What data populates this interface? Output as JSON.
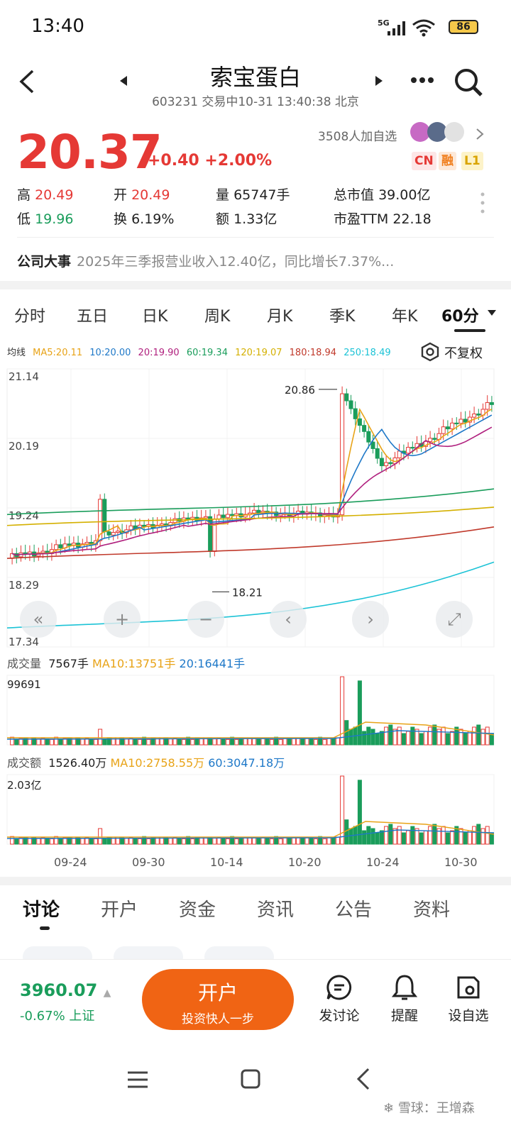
{
  "status": {
    "time": "13:40",
    "network": "5G",
    "battery": "86"
  },
  "header": {
    "title": "索宝蛋白",
    "subtitle": "603231 交易中10-31 13:40:38 北京"
  },
  "quote": {
    "price": "20.37",
    "change": "+0.40",
    "change_pct": "+2.00%",
    "followers": "3508人加自选",
    "badges": [
      "CN",
      "融",
      "L1"
    ],
    "stats": [
      {
        "label": "高",
        "value": "20.49",
        "color": "red"
      },
      {
        "label": "开",
        "value": "20.49",
        "color": "red"
      },
      {
        "label": "量",
        "value": "65747手",
        "color": "none"
      },
      {
        "label": "总市值",
        "value": "39.00亿",
        "color": "none"
      },
      {
        "label": "低",
        "value": "19.96",
        "color": "grn"
      },
      {
        "label": "换",
        "value": "6.19%",
        "color": "none"
      },
      {
        "label": "额",
        "value": "1.33亿",
        "color": "none"
      },
      {
        "label": "市盈TTM",
        "value": "22.18",
        "color": "none"
      }
    ]
  },
  "news": {
    "label": "公司大事",
    "text": "2025年三季报营业收入12.40亿，同比增长7.37%..."
  },
  "period_tabs": [
    "分时",
    "五日",
    "日K",
    "周K",
    "月K",
    "季K",
    "年K",
    "60分"
  ],
  "ma_line": {
    "label": "均线",
    "items": [
      {
        "text": "MA5:20.11",
        "color": "#e8a317"
      },
      {
        "text": "10:20.00",
        "color": "#1e78c8"
      },
      {
        "text": "20:19.90",
        "color": "#b0207e"
      },
      {
        "text": "60:19.34",
        "color": "#1a9d5b"
      },
      {
        "text": "120:19.07",
        "color": "#d4b000"
      },
      {
        "text": "180:18.94",
        "color": "#c0392b"
      },
      {
        "text": "250:18.49",
        "color": "#1cc3d6"
      }
    ],
    "restore": "不复权"
  },
  "chart_data": {
    "type": "candlestick",
    "price_axis": [
      "21.14",
      "20.19",
      "19.24",
      "18.29",
      "17.34"
    ],
    "ylim": [
      17.34,
      21.14
    ],
    "high_label": "20.86",
    "low_label": "18.21",
    "x_labels": [
      "09-24",
      "09-30",
      "10-14",
      "10-20",
      "10-24",
      "10-30"
    ]
  },
  "volume": {
    "label": "成交量",
    "value": "7567手",
    "ma10": "MA10:13751手",
    "ma20": "20:16441手",
    "max": "99691"
  },
  "turnover": {
    "label": "成交额",
    "value": "1526.40万",
    "ma10": "MA10:2758.55万",
    "ma60": "60:3047.18万",
    "max": "2.03亿"
  },
  "bottom_tabs": [
    "讨论",
    "开户",
    "资金",
    "资讯",
    "公告",
    "资料"
  ],
  "index": {
    "value": "3960.07",
    "change": "-0.67%",
    "name": "上证"
  },
  "open_button": {
    "title": "开户",
    "subtitle": "投资快人一步"
  },
  "actions": [
    "发讨论",
    "提醒",
    "设自选"
  ],
  "watermark": "雪球：王增森"
}
